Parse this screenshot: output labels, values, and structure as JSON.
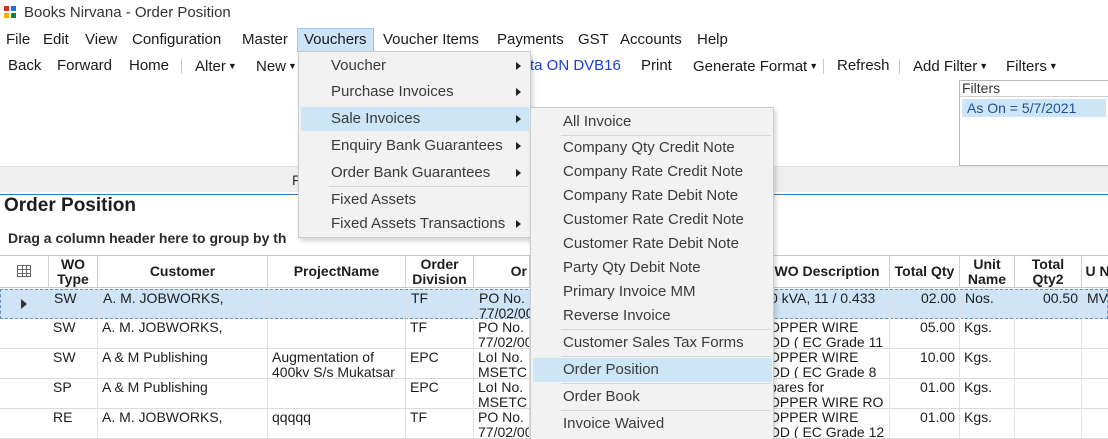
{
  "window": {
    "title": "Books Nirvana - Order Position"
  },
  "menubar": {
    "items": [
      "File",
      "Edit",
      "View",
      "Configuration",
      "Master",
      "Vouchers",
      "Voucher Items",
      "Payments",
      "GST",
      "Accounts",
      "Help"
    ],
    "active": "Vouchers"
  },
  "toolbar": {
    "back": "Back",
    "forward": "Forward",
    "home": "Home",
    "alter": "Alter",
    "new": "New",
    "data_source": "ta ON DVB16",
    "print": "Print",
    "generate_format": "Generate Format",
    "refresh": "Refresh",
    "add_filter": "Add Filter",
    "filters": "Filters"
  },
  "filters_panel": {
    "title": "Filters",
    "chip": "As On =  5/7/2021"
  },
  "panel_bar": {
    "text": "F"
  },
  "section": {
    "title": "Order Position",
    "group_hint": "Drag a column header here to group by th"
  },
  "vouchers_menu": {
    "items": [
      {
        "label": "Voucher",
        "submenu": true
      },
      {
        "label": "Purchase Invoices",
        "submenu": true
      },
      {
        "label": "Sale Invoices",
        "submenu": true,
        "highlighted": true
      },
      {
        "label": "Enquiry Bank Guarantees",
        "submenu": true
      },
      {
        "label": "Order Bank Guarantees",
        "submenu": true
      },
      {
        "label": "Fixed Assets",
        "submenu": false
      },
      {
        "label": "Fixed Assets Transactions",
        "submenu": true
      }
    ]
  },
  "sale_invoices_menu": {
    "items": [
      {
        "label": "All Invoice"
      },
      {
        "label": "Company Qty Credit Note"
      },
      {
        "label": "Company Rate Credit Note"
      },
      {
        "label": "Company Rate Debit Note"
      },
      {
        "label": "Customer Rate Credit Note"
      },
      {
        "label": "Customer Rate Debit Note"
      },
      {
        "label": "Party Qty Debit Note"
      },
      {
        "label": "Primary Invoice MM"
      },
      {
        "label": "Reverse Invoice"
      },
      {
        "label": "Customer Sales Tax Forms"
      },
      {
        "label": "Order Position",
        "highlighted": true
      },
      {
        "label": "Order Book"
      },
      {
        "label": "Invoice Waived"
      }
    ]
  },
  "grid": {
    "columns": [
      "",
      "WO\nType",
      "Customer",
      "ProjectName",
      "Order\nDivision",
      "Or",
      "",
      "WO Description",
      "Total Qty",
      "Unit\nName",
      "Total\nQty2",
      "U\nNa"
    ],
    "rows": [
      [
        "SW",
        "A. M. JOBWORKS,",
        "",
        "TF",
        "PO No.\n77/02/00",
        "",
        "0 kVA, 11 / 0.433",
        "02.00",
        "Nos.",
        "00.50",
        "MV"
      ],
      [
        "SW",
        "A. M. JOBWORKS,",
        "",
        "TF",
        "PO No.\n77/02/00",
        "",
        "OPPER WIRE\nOD ( EC Grade 11",
        "05.00",
        "Kgs.",
        "",
        ""
      ],
      [
        "SW",
        "A & M Publishing",
        "Augmentation of\n400kv S/s Mukatsar",
        "EPC",
        "LoI No.\nMSETC",
        "",
        "OPPER WIRE\nOD ( EC Grade   8",
        "10.00",
        "Kgs.",
        "",
        ""
      ],
      [
        "SP",
        "A & M Publishing",
        "",
        "EPC",
        "LoI No.\nMSETC",
        "",
        "pares for\nOPPER WIRE RO",
        "01.00",
        "Kgs.",
        "",
        ""
      ],
      [
        "RE",
        "A. M. JOBWORKS,",
        "qqqqq",
        "TF",
        "PO No.\n77/02/00",
        "",
        "OPPER WIRE\nOD ( EC Grade 12",
        "01.00",
        "Kgs.",
        "",
        ""
      ]
    ]
  },
  "colors": {
    "accent": "#2b7cc3",
    "highlight": "#cde6f7",
    "menu_bg": "#f2f2f2",
    "link_blue": "#1a3fd0"
  }
}
